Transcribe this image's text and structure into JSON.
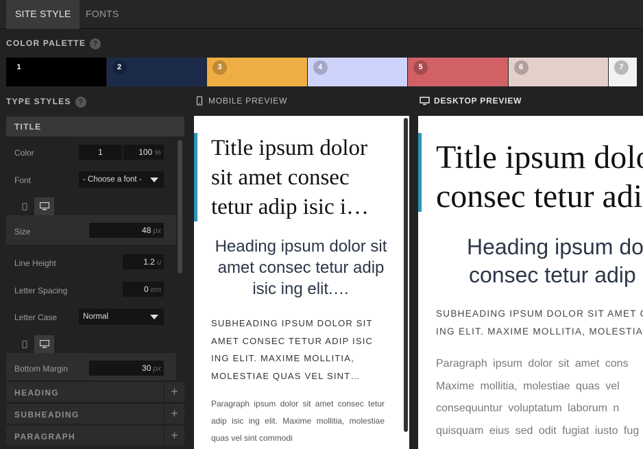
{
  "tabs": [
    {
      "label": "SITE STYLE",
      "active": true
    },
    {
      "label": "FONTS",
      "active": false
    }
  ],
  "color_palette": {
    "header": "COLOR PALETTE",
    "swatches": [
      {
        "num": "1",
        "color": "#000000"
      },
      {
        "num": "2",
        "color": "#1d2b4a"
      },
      {
        "num": "3",
        "color": "#efad45"
      },
      {
        "num": "4",
        "color": "#cdd3fa"
      },
      {
        "num": "5",
        "color": "#d16165"
      },
      {
        "num": "6",
        "color": "#e4d0cb"
      },
      {
        "num": "7",
        "color": "#f2f2f2"
      }
    ]
  },
  "type_styles": {
    "header": "TYPE STYLES",
    "title_section": {
      "label": "TITLE",
      "color_label": "Color",
      "color_value": "1",
      "opacity_value": "100",
      "opacity_unit": "%",
      "font_label": "Font",
      "font_value": "- Choose a font -",
      "size_label": "Size",
      "size_value": "48",
      "size_unit": "px",
      "line_height_label": "Line Height",
      "line_height_value": "1.2",
      "line_height_unit": "u",
      "letter_spacing_label": "Letter Spacing",
      "letter_spacing_value": "0",
      "letter_spacing_unit": "em",
      "letter_case_label": "Letter Case",
      "letter_case_value": "Normal",
      "bottom_margin_label": "Bottom Margin",
      "bottom_margin_value": "30",
      "bottom_margin_unit": "px"
    },
    "collapsed_sections": [
      "HEADING",
      "SUBHEADING",
      "PARAGRAPH"
    ]
  },
  "mobile_preview": {
    "label": "MOBILE PREVIEW",
    "title": "Title ipsum dolor sit amet consec tetur adip isic i…",
    "heading": "Heading ipsum dolor sit amet consec tetur adip isic ing elit.…",
    "subheading": "SUBHEADING IPSUM DOLOR SIT AMET CONSEC TETUR ADIP ISIC ING ELIT. MAXIME MOLLITIA, MOLESTIAE QUAS VEL SINT…",
    "paragraph": "Paragraph ipsum dolor sit amet consec tetur adip isic ing elit. Maxime mollitia, molestiae quas vel sint commodi"
  },
  "desktop_preview": {
    "label": "DESKTOP PREVIEW",
    "title_lines": [
      "Title ipsum dolor",
      "consec tetur adi"
    ],
    "heading_lines": [
      "Heading ipsum do",
      "consec tetur adip"
    ],
    "subheading_lines": [
      "SUBHEADING IPSUM DOLOR SIT AMET C",
      "ING ELIT. MAXIME MOLLITIA, MOLESTIA"
    ],
    "paragraph_lines": [
      "Paragraph ipsum dolor sit amet cons",
      "Maxime mollitia, molestiae quas vel",
      "consequuntur voluptatum laborum n",
      "quisquam eius sed odit fugiat iusto fug"
    ]
  },
  "accent_color": "#2d94b5"
}
